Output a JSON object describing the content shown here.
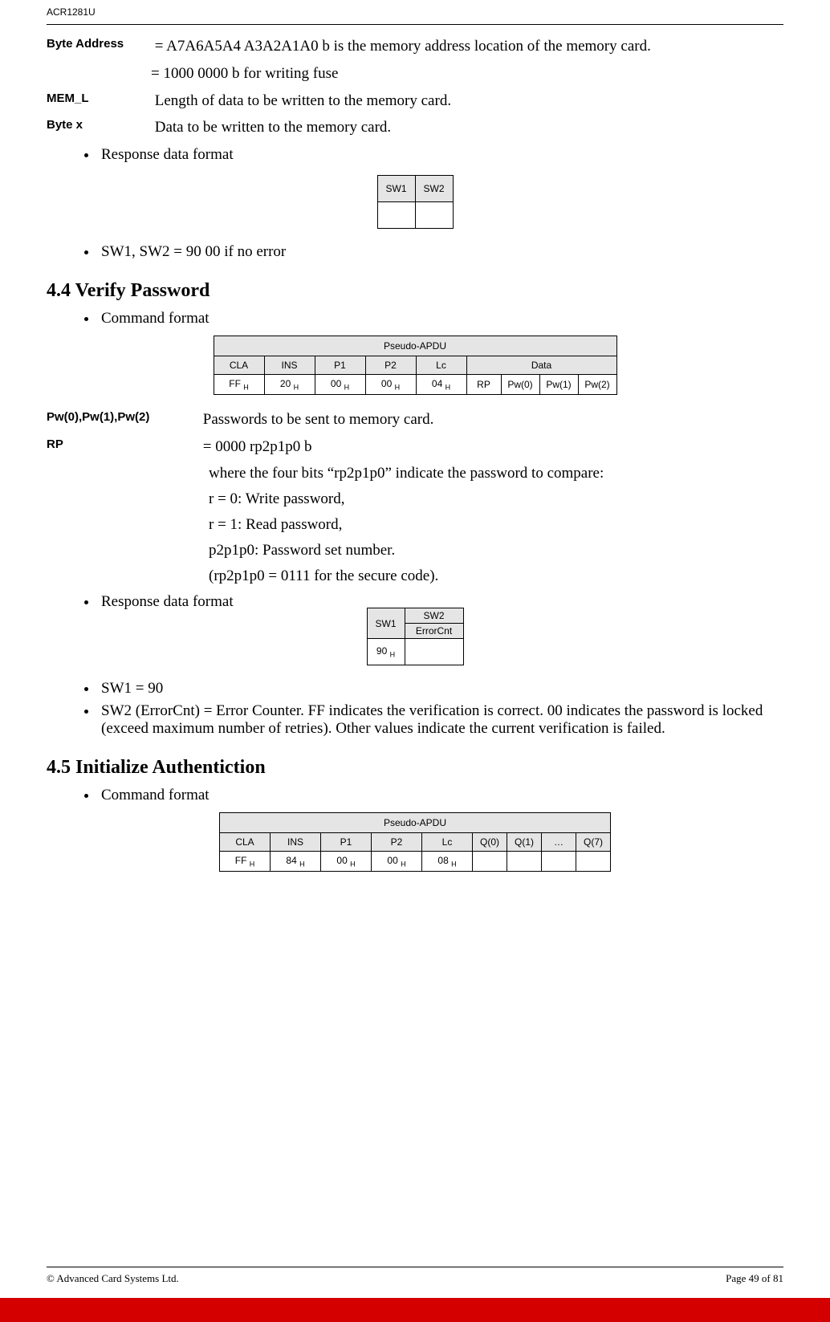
{
  "header": {
    "device": "ACR1281U"
  },
  "byte_address": {
    "label": "Byte Address",
    "line1": "= A7A6A5A4 A3A2A1A0 b is the memory address location of the memory card.",
    "line2": "= 1000 0000 b for writing fuse"
  },
  "mem_l": {
    "label": "MEM_L",
    "text": "Length of data to be written to the memory card."
  },
  "byte_x": {
    "label": "Byte x",
    "text": "Data to be written to the memory card."
  },
  "bullets1": {
    "response_format": "Response data format",
    "sw_equals": "SW1, SW2      = 90  00  if no error"
  },
  "sw_headers": {
    "sw1": "SW1",
    "sw2": "SW2"
  },
  "section44": {
    "title": "4.4 Verify Password",
    "command_format": "Command format"
  },
  "table44": {
    "title": "Pseudo-APDU",
    "headers": {
      "cla": "CLA",
      "ins": "INS",
      "p1": "P1",
      "p2": "P2",
      "lc": "Lc",
      "data": "Data"
    },
    "values": {
      "cla": "FF",
      "ins": "20",
      "p1": "00",
      "p2": "00",
      "lc": "04",
      "rp": "RP",
      "pw0": "Pw(0)",
      "pw1": "Pw(1)",
      "pw2": "Pw(2)"
    }
  },
  "pw_def": {
    "label": "Pw(0),Pw(1),Pw(2)",
    "text": "Passwords to be sent to memory card."
  },
  "rp_def": {
    "label": "RP",
    "line1": "= 0000 rp2p1p0 b",
    "line2": "where the four bits “rp2p1p0” indicate the password to compare:",
    "line3": "r = 0: Write password,",
    "line4": "r = 1: Read password,",
    "line5": "p2p1p0: Password set number.",
    "line6": "(rp2p1p0 = 0111 for the secure code)."
  },
  "sw_table44": {
    "sw1": "SW1",
    "sw2": "SW2",
    "errorcnt": "ErrorCnt",
    "val90": "90"
  },
  "bullets44b": {
    "sw1_90": "SW1 = 90",
    "sw2_text": "SW2 (ErrorCnt) = Error Counter.  FF indicates the verification is correct.  00 indicates the password is locked (exceed maximum number of retries).  Other values indicate the current verification is failed."
  },
  "section45": {
    "title": "4.5 Initialize Authentiction",
    "command_format": "Command format"
  },
  "table45": {
    "title": "Pseudo-APDU",
    "headers": {
      "cla": "CLA",
      "ins": "INS",
      "p1": "P1",
      "p2": "P2",
      "lc": "Lc",
      "q0": "Q(0)",
      "q1": "Q(1)",
      "dots": "…",
      "q7": "Q(7)"
    },
    "values": {
      "cla": "FF",
      "ins": "84",
      "p1": "00",
      "p2": "00",
      "lc": "08"
    }
  },
  "footer": {
    "copyright": "© Advanced Card Systems Ltd.",
    "page": "Page 49 of 81"
  }
}
